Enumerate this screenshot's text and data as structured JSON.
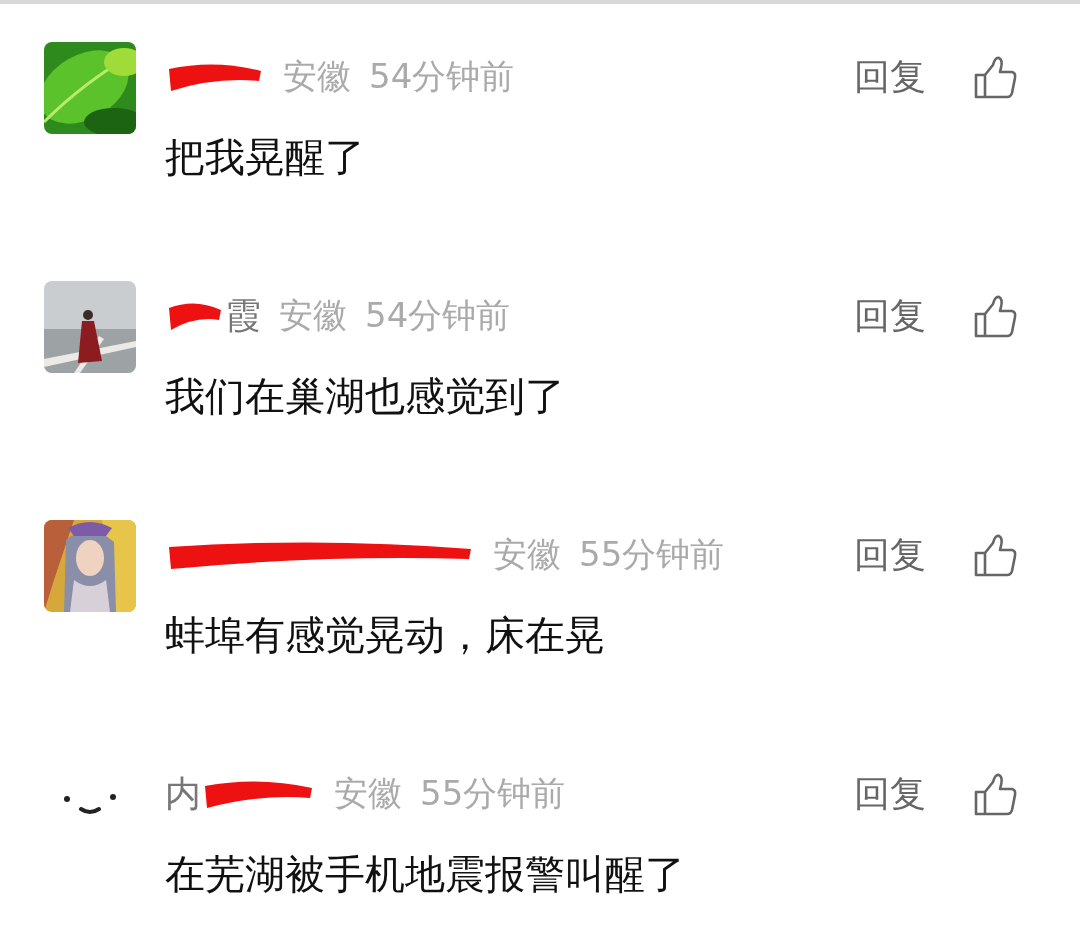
{
  "comments": [
    {
      "avatar": {
        "kind": "picture"
      },
      "name": [
        {
          "kind": "redacted"
        }
      ],
      "location": "安徽",
      "time": "54分钟前",
      "reply": "回复",
      "text": "把我晃醒了"
    },
    {
      "avatar": {
        "kind": "picture"
      },
      "name": [
        {
          "kind": "redacted"
        },
        {
          "kind": "text",
          "text": "霞"
        }
      ],
      "location": "安徽",
      "time": "54分钟前",
      "reply": "回复",
      "text": "我们在巢湖也感觉到了"
    },
    {
      "avatar": {
        "kind": "picture"
      },
      "name": [
        {
          "kind": "redacted"
        }
      ],
      "location": "安徽",
      "time": "55分钟前",
      "reply": "回复",
      "text": "蚌埠有感觉晃动，床在晃"
    },
    {
      "avatar": {
        "kind": "smiley"
      },
      "name": [
        {
          "kind": "text",
          "text": "内"
        },
        {
          "kind": "redacted"
        }
      ],
      "location": "安徽",
      "time": "55分钟前",
      "reply": "回复",
      "text": "在芜湖被手机地震报警叫醒了"
    }
  ]
}
